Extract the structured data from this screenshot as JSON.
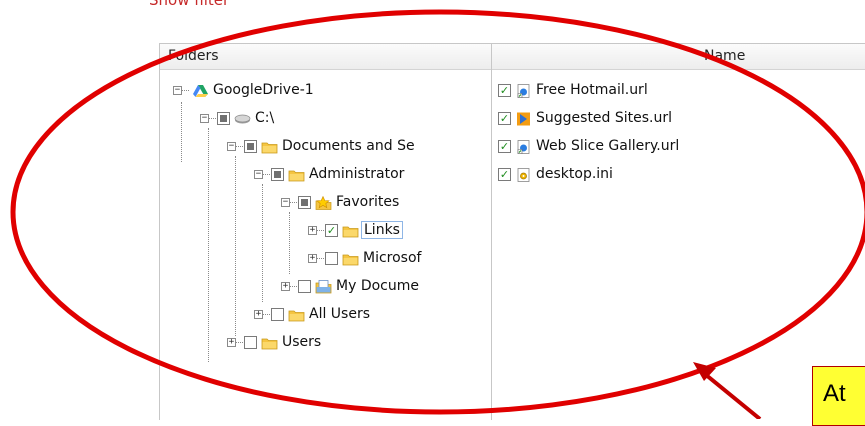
{
  "top": {
    "show_filter": "Show filter"
  },
  "columns": {
    "folders": "Folders",
    "name": "Name"
  },
  "tree": [
    {
      "label": "GoogleDrive-1",
      "icon": "google-drive-icon",
      "expander": "minus",
      "checkbox": "none"
    },
    {
      "label": "C:\\",
      "icon": "drive-icon",
      "expander": "minus",
      "checkbox": "partial"
    },
    {
      "label": "Documents and Se",
      "icon": "folder-icon",
      "expander": "minus",
      "checkbox": "partial"
    },
    {
      "label": "Administrator",
      "icon": "folder-icon",
      "expander": "minus",
      "checkbox": "partial"
    },
    {
      "label": "Favorites",
      "icon": "favorites-star-icon",
      "expander": "minus",
      "checkbox": "partial"
    },
    {
      "label": "Links",
      "icon": "folder-icon",
      "expander": "plus",
      "checkbox": "checked",
      "selected": true
    },
    {
      "label": "Microsof",
      "icon": "folder-icon",
      "expander": "plus",
      "checkbox": "unchecked"
    },
    {
      "label": "My Docume",
      "icon": "documents-icon",
      "expander": "plus",
      "checkbox": "unchecked"
    },
    {
      "label": "All Users",
      "icon": "folder-icon",
      "expander": "plus",
      "checkbox": "unchecked"
    },
    {
      "label": "Users",
      "icon": "folder-icon",
      "expander": "plus",
      "checkbox": "unchecked"
    }
  ],
  "files": [
    {
      "label": "Free Hotmail.url",
      "icon": "url-shortcut-icon",
      "checked": true
    },
    {
      "label": "Suggested Sites.url",
      "icon": "suggested-sites-icon",
      "checked": true
    },
    {
      "label": "Web Slice Gallery.url",
      "icon": "url-shortcut-icon",
      "checked": true
    },
    {
      "label": "desktop.ini",
      "icon": "ini-settings-icon",
      "checked": true
    }
  ],
  "callout": {
    "text": "At"
  },
  "colors": {
    "annotation_red": "#e00000",
    "callout_yellow": "#ffff33",
    "folder_yellow": "#f5c542",
    "check_green": "#1e8c1e"
  }
}
